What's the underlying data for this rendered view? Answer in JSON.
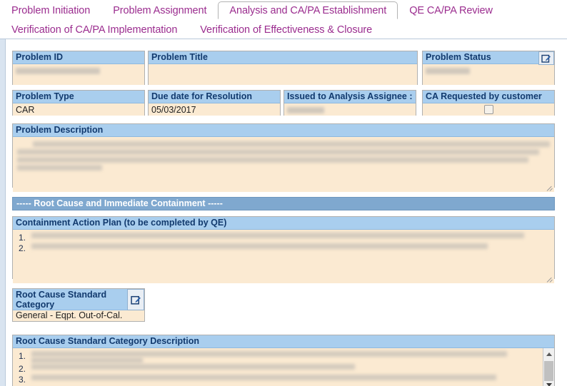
{
  "tabs": {
    "row1": [
      {
        "label": "Problem Initiation",
        "active": false
      },
      {
        "label": "Problem Assignment",
        "active": false
      },
      {
        "label": "Analysis and CA/PA Establishment",
        "active": true
      },
      {
        "label": "QE CA/PA Review",
        "active": false
      }
    ],
    "row2": [
      {
        "label": "Verification of CA/PA Implementation",
        "active": false
      },
      {
        "label": "Verification of Effectiveness & Closure",
        "active": false
      }
    ]
  },
  "fields": {
    "problem_id": {
      "label": "Problem ID",
      "value": "",
      "redacted": true
    },
    "problem_title": {
      "label": "Problem Title",
      "value": ""
    },
    "problem_status": {
      "label": "Problem Status",
      "value": "",
      "redacted": true,
      "edit_icon": "edit-pencil-icon"
    },
    "problem_type": {
      "label": "Problem Type",
      "value": "CAR"
    },
    "due_date": {
      "label": "Due date for Resolution",
      "value": "05/03/2017"
    },
    "analysis_assignee": {
      "label": "Issued to Analysis Assignee :",
      "value": "",
      "redacted": true
    },
    "ca_requested": {
      "label": "CA Requested by customer",
      "checked": false
    },
    "problem_description": {
      "label": "Problem Description",
      "lines": [
        "The Manufacturing process is not effective in providing suitable monitoring and measuring equipment. A",
        "battery operated screwdriver was found in use at off-call 8.00 to torque hardware with a torque requirement of 7",
        "in-lbs. 7.1.3    Controlled conditions shall include a) the availability and use of monitoring and measuring",
        "equipment."
      ]
    },
    "section_divider": {
      "label": "----- Root Cause and Immediate Containment -----"
    },
    "containment_plan": {
      "label": "Containment Action Plan (to be completed by QE)",
      "items": [
        {
          "num": "1.",
          "text": "All battery operated screwdrivers in off-call were removed and relabeled 'No Calibration Required' _####."
        },
        {
          "num": "2.",
          "text": "Training to be conducted to off-call operators for proper use of battery operated screwdrivers."
        }
      ]
    },
    "root_cause_category": {
      "label": "Root Cause Standard Category",
      "value": "General - Eqpt. Out-of-Cal.",
      "edit_icon": "edit-pencil-icon"
    },
    "root_cause_description": {
      "label": "Root Cause Standard Category Description",
      "items": [
        {
          "num": "1.",
          "text": "Operator was using incorrect settings numbers on spindle of battery operated screwdriver to install hardware into part. _####"
        },
        {
          "num": "2.",
          "text": "Setup instructions were not way clear for operator to use drawing. _####"
        },
        {
          "num": "3.",
          "text": "Operator assigned the job a sub-lot assembly; the job cross checked and hardware assembly so the spindle is"
        }
      ]
    }
  },
  "colors": {
    "tab_text": "#9b2d8f",
    "field_header_bg": "#a9ceee",
    "field_header_text": "#123a6e",
    "field_body_bg": "#fbead2",
    "divider_bg": "#7fa8cf",
    "divider_text": "#ffffff",
    "border": "#b0b0b0"
  },
  "scrollbar": {
    "up_arrow": "triangle-up-icon",
    "down_arrow": "triangle-down-icon",
    "thumb": "scroll-thumb"
  }
}
